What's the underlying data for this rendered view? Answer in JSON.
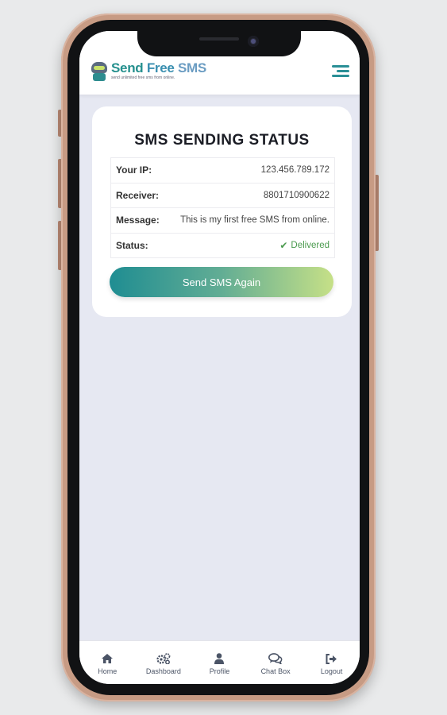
{
  "header": {
    "logo_title_1": "Send",
    "logo_title_2": "Free",
    "logo_title_3": "SMS",
    "logo_tagline": "send unlimited free sms from online.",
    "menu_icon": "hamburger-menu-icon"
  },
  "status_card": {
    "title": "SMS SENDING STATUS",
    "rows": [
      {
        "label": "Your IP:",
        "value": "123.456.789.172"
      },
      {
        "label": "Receiver:",
        "value": "8801710900622"
      },
      {
        "label": "Message:",
        "value": "This is my first free SMS from online."
      },
      {
        "label": "Status:",
        "value": "Delivered",
        "icon": "check-icon",
        "color": "#4a9a4e"
      }
    ],
    "button_label": "Send SMS Again",
    "button_gradient": [
      "#1f8d92",
      "#c6e087"
    ]
  },
  "bottom_nav": {
    "items": [
      {
        "label": "Home",
        "icon": "home-icon"
      },
      {
        "label": "Dashboard",
        "icon": "cogs-icon"
      },
      {
        "label": "Profile",
        "icon": "user-icon"
      },
      {
        "label": "Chat Box",
        "icon": "chat-icon"
      },
      {
        "label": "Logout",
        "icon": "logout-icon"
      }
    ]
  },
  "colors": {
    "accent": "#25908e",
    "background": "#e6e8f2",
    "phone_frame": "#c79b84"
  }
}
